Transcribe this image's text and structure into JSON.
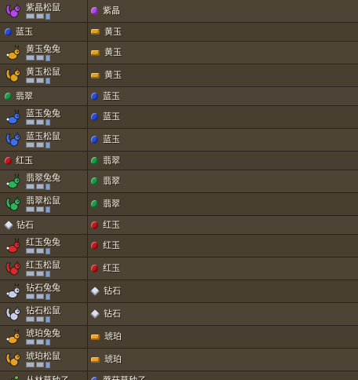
{
  "rows": [
    {
      "name": "紫晶松鼠",
      "critter": "squirrel",
      "color": "#b348e6",
      "sub": true,
      "mat": "紫晶",
      "matIcon": "amethyst-icon",
      "matColor": "#b348e6"
    },
    {
      "name": "蓝玉",
      "critter": "gem",
      "color": "#2a4bd6",
      "sub": false,
      "mat": "黄玉",
      "matIcon": "topaz-icon",
      "matColor": "#e0a21a"
    },
    {
      "name": "黄玉兔兔",
      "critter": "bunny",
      "color": "#e0a21a",
      "sub": true,
      "mat": "黄玉",
      "matIcon": "topaz-icon",
      "matColor": "#e0a21a"
    },
    {
      "name": "黄玉松鼠",
      "critter": "squirrel",
      "color": "#e0a21a",
      "sub": true,
      "mat": "黄玉",
      "matIcon": "topaz-icon",
      "matColor": "#e0a21a"
    },
    {
      "name": "翡翠",
      "critter": "gem",
      "color": "#1f9a4a",
      "sub": false,
      "mat": "蓝玉",
      "matIcon": "sapphire-icon",
      "matColor": "#2a4bd6"
    },
    {
      "name": "蓝玉兔兔",
      "critter": "bunny",
      "color": "#3d6fe8",
      "sub": true,
      "mat": "蓝玉",
      "matIcon": "sapphire-icon",
      "matColor": "#2a4bd6"
    },
    {
      "name": "蓝玉松鼠",
      "critter": "squirrel",
      "color": "#3d6fe8",
      "sub": true,
      "mat": "蓝玉",
      "matIcon": "sapphire-icon",
      "matColor": "#2a4bd6"
    },
    {
      "name": "红玉",
      "critter": "gem",
      "color": "#c4161c",
      "sub": false,
      "mat": "翡翠",
      "matIcon": "emerald-icon",
      "matColor": "#1f9a4a"
    },
    {
      "name": "翡翠兔兔",
      "critter": "bunny",
      "color": "#2fb35a",
      "sub": true,
      "mat": "翡翠",
      "matIcon": "emerald-icon",
      "matColor": "#1f9a4a"
    },
    {
      "name": "翡翠松鼠",
      "critter": "squirrel",
      "color": "#2fb35a",
      "sub": true,
      "mat": "翡翠",
      "matIcon": "emerald-icon",
      "matColor": "#1f9a4a"
    },
    {
      "name": "钻石",
      "critter": "gem-diamond",
      "color": "#d9e0f2",
      "sub": false,
      "mat": "红玉",
      "matIcon": "ruby-icon",
      "matColor": "#c4161c"
    },
    {
      "name": "红玉兔兔",
      "critter": "bunny",
      "color": "#d92a2a",
      "sub": true,
      "mat": "红玉",
      "matIcon": "ruby-icon",
      "matColor": "#c4161c"
    },
    {
      "name": "红玉松鼠",
      "critter": "squirrel",
      "color": "#d92a2a",
      "sub": true,
      "mat": "红玉",
      "matIcon": "ruby-icon",
      "matColor": "#c4161c"
    },
    {
      "name": "钻石兔兔",
      "critter": "bunny",
      "color": "#c9cde8",
      "sub": true,
      "mat": "钻石",
      "matIcon": "diamond-icon",
      "matColor": "#d9e0f2"
    },
    {
      "name": "钻石松鼠",
      "critter": "squirrel",
      "color": "#c9cde8",
      "sub": true,
      "mat": "钻石",
      "matIcon": "diamond-icon",
      "matColor": "#d9e0f2"
    },
    {
      "name": "琥珀兔兔",
      "critter": "bunny",
      "color": "#e8a027",
      "sub": true,
      "mat": "琥珀",
      "matIcon": "amber-icon",
      "matColor": "#f0a023"
    },
    {
      "name": "琥珀松鼠",
      "critter": "squirrel",
      "color": "#e8a027",
      "sub": true,
      "mat": "琥珀",
      "matIcon": "amber-icon",
      "matColor": "#f0a023"
    },
    {
      "name": "丛林草种子",
      "critter": "seed",
      "color": "#3d9b3a",
      "sub": false,
      "mat": "蘑菇草种子",
      "matIcon": "mushroom-grass-seeds-icon",
      "matColor": "#4a5bd8"
    }
  ]
}
